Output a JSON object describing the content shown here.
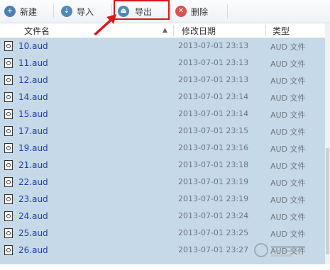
{
  "toolbar": {
    "new_label": "新建",
    "import_label": "导入",
    "export_label": "导出",
    "delete_label": "删除"
  },
  "columns": {
    "name": "文件名",
    "modified": "修改日期",
    "type": "类型"
  },
  "files": [
    {
      "name": "10.aud",
      "date": "2013-07-01 23:13",
      "type": "AUD 文件"
    },
    {
      "name": "11.aud",
      "date": "2013-07-01 23:13",
      "type": "AUD 文件"
    },
    {
      "name": "12.aud",
      "date": "2013-07-01 23:13",
      "type": "AUD 文件"
    },
    {
      "name": "14.aud",
      "date": "2013-07-01 23:14",
      "type": "AUD 文件"
    },
    {
      "name": "15.aud",
      "date": "2013-07-01 23:14",
      "type": "AUD 文件"
    },
    {
      "name": "17.aud",
      "date": "2013-07-01 23:15",
      "type": "AUD 文件"
    },
    {
      "name": "19.aud",
      "date": "2013-07-01 23:16",
      "type": "AUD 文件"
    },
    {
      "name": "21.aud",
      "date": "2013-07-01 23:18",
      "type": "AUD 文件"
    },
    {
      "name": "22.aud",
      "date": "2013-07-01 23:19",
      "type": "AUD 文件"
    },
    {
      "name": "23.aud",
      "date": "2013-07-01 23:19",
      "type": "AUD 文件"
    },
    {
      "name": "24.aud",
      "date": "2013-07-01 23:24",
      "type": "AUD 文件"
    },
    {
      "name": "25.aud",
      "date": "2013-07-01 23:25",
      "type": "AUD 文件"
    },
    {
      "name": "26.aud",
      "date": "2013-07-01 23:27",
      "type": "AUD 文件"
    }
  ],
  "colors": {
    "selection": "#c6d9e8",
    "highlight": "#d7191c",
    "filename": "#1f3fa6"
  },
  "icons": {
    "new": "new-folder-icon",
    "import": "import-icon",
    "export": "export-icon",
    "delete": "delete-icon",
    "file": "audio-file-icon"
  }
}
